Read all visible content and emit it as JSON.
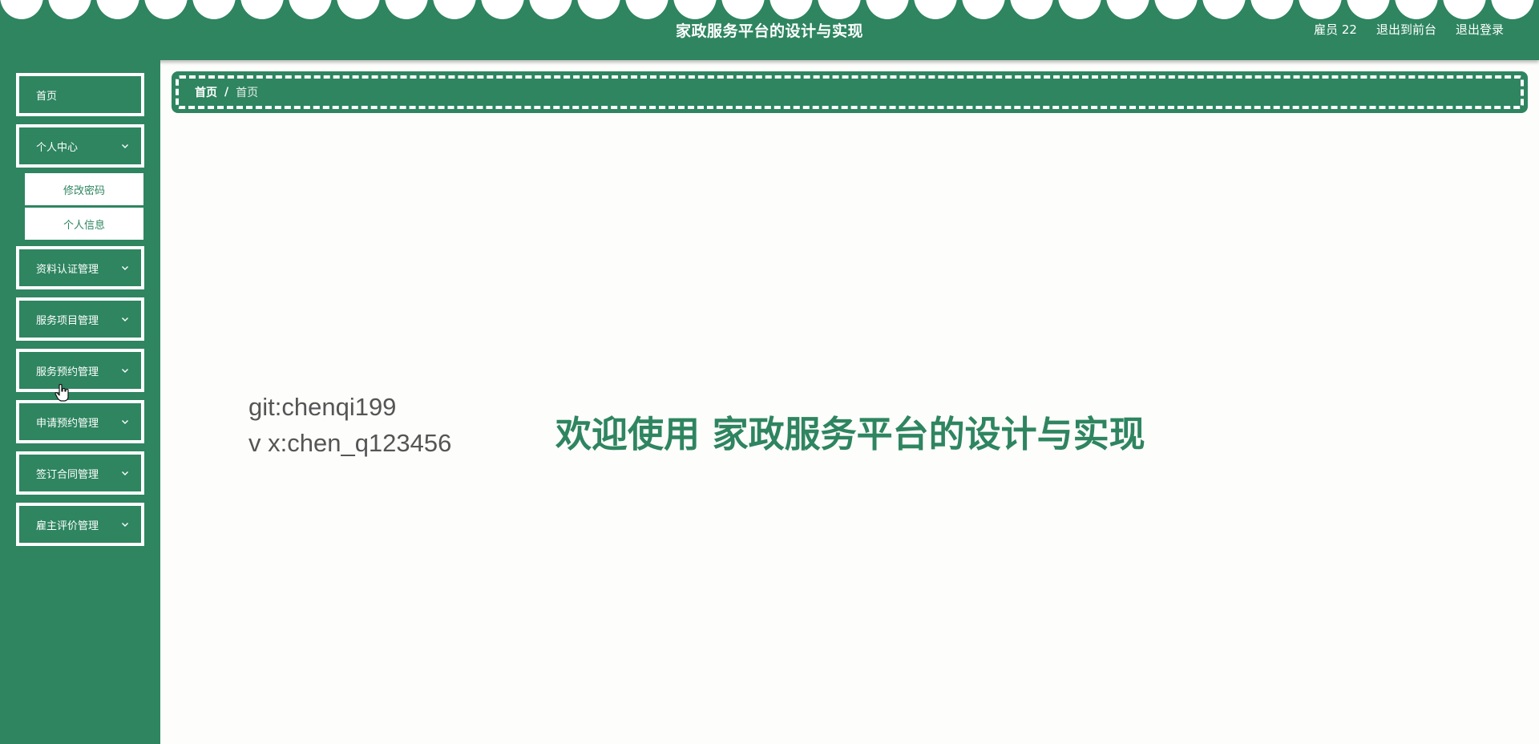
{
  "header": {
    "title": "家政服务平台的设计与实现",
    "user": "雇员 22",
    "to_front": "退出到前台",
    "logout": "退出登录"
  },
  "sidebar": {
    "items": [
      {
        "label": "首页",
        "has_children": false
      },
      {
        "label": "个人中心",
        "has_children": true,
        "expanded": true,
        "children": [
          {
            "label": "修改密码"
          },
          {
            "label": "个人信息"
          }
        ]
      },
      {
        "label": "资料认证管理",
        "has_children": true
      },
      {
        "label": "服务项目管理",
        "has_children": true
      },
      {
        "label": "服务预约管理",
        "has_children": true
      },
      {
        "label": "申请预约管理",
        "has_children": true
      },
      {
        "label": "签订合同管理",
        "has_children": true
      },
      {
        "label": "雇主评价管理",
        "has_children": true
      }
    ]
  },
  "breadcrumb": {
    "home": "首页",
    "separator": "/",
    "current": "首页"
  },
  "main": {
    "git": "git:chenqi199",
    "vx": "v x:chen_q123456",
    "welcome": "欢迎使用 家政服务平台的设计与实现"
  },
  "colors": {
    "primary": "#2e8560",
    "white": "#ffffff",
    "background": "#fdfdfb",
    "text_gray": "#555555"
  },
  "icons": {
    "menu_expand": "chevron-down-icon",
    "pointer": "hand-cursor-icon"
  }
}
